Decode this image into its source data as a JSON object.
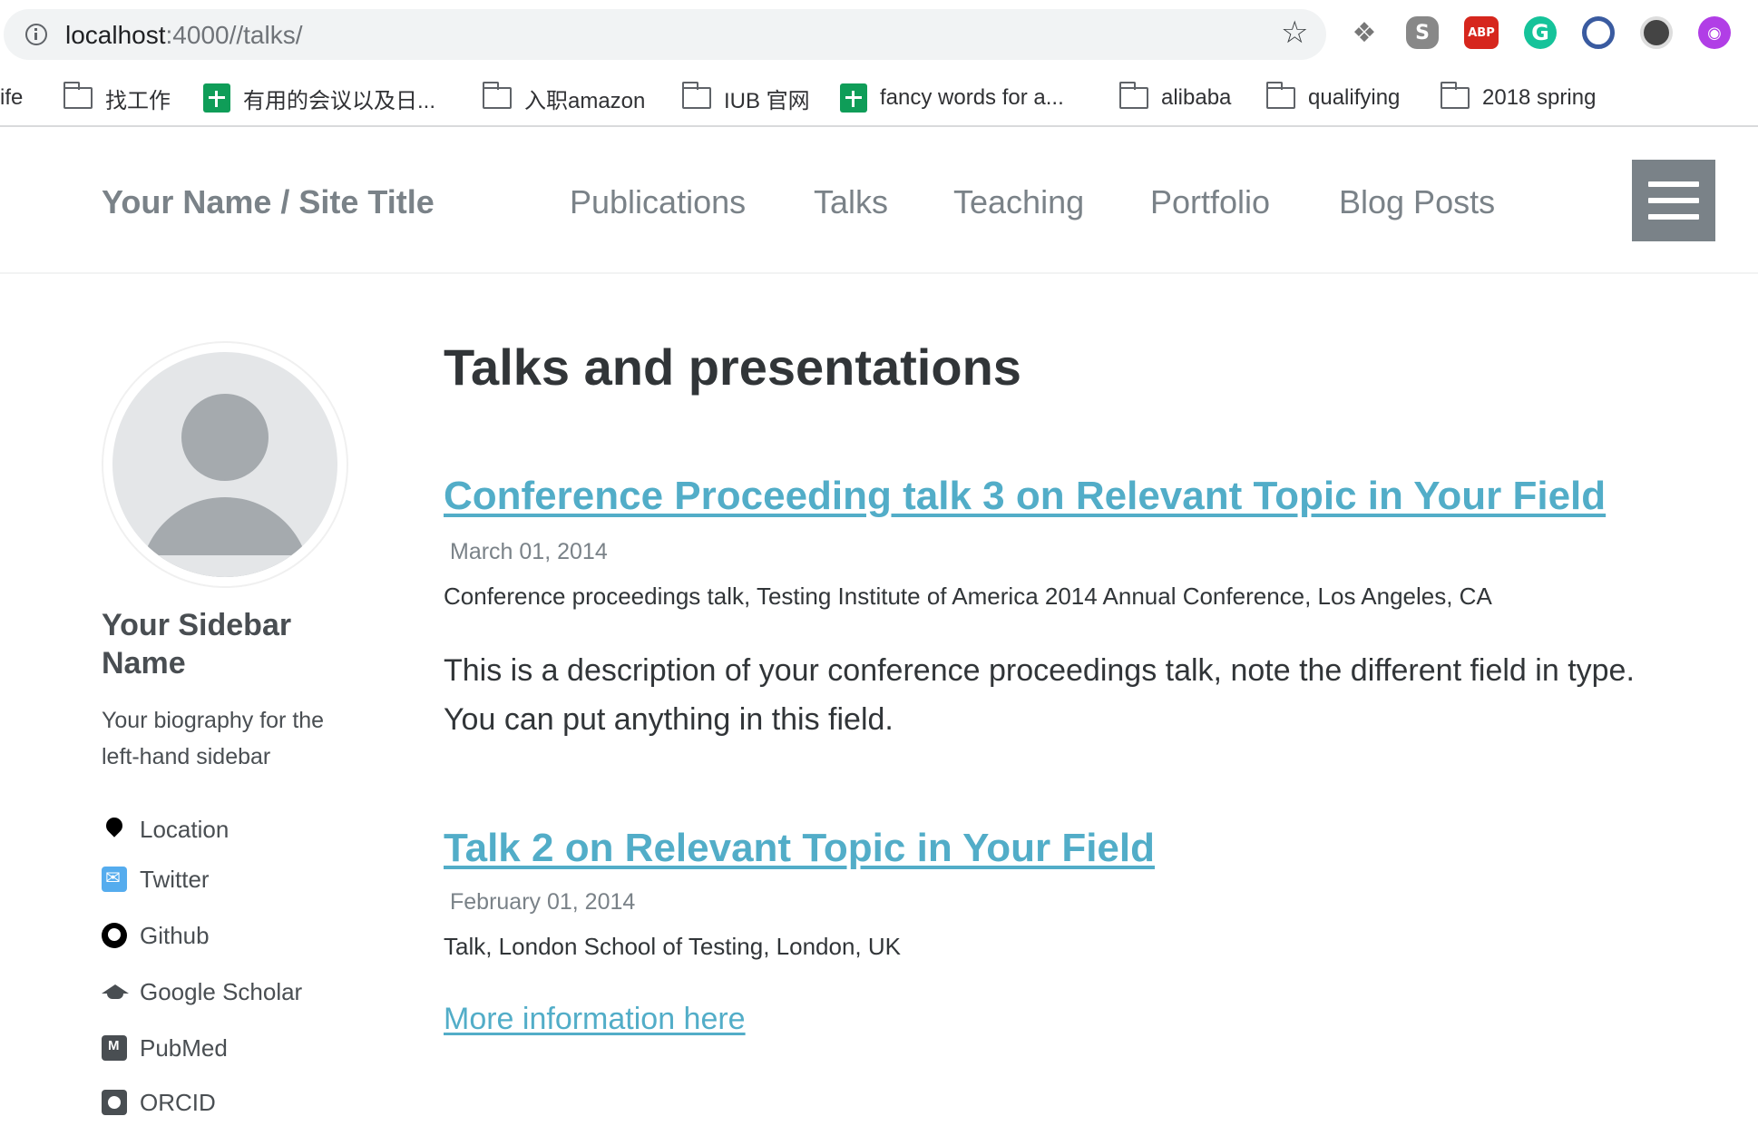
{
  "browser": {
    "url_host": "localhost",
    "url_rest": ":4000//talks/",
    "extensions": [
      "dropbox-icon",
      "skype-icon",
      "adblock-plus-icon",
      "grammarly-icon",
      "q-extension-icon",
      "moon-extension-icon",
      "octo-extension-icon"
    ],
    "abp_label": "ABP",
    "grammarly_label": "G",
    "bookmarks": [
      {
        "label": "ife",
        "icon": "none"
      },
      {
        "label": "找工作",
        "icon": "folder-icon"
      },
      {
        "label": "有用的会议以及日...",
        "icon": "sheets-icon"
      },
      {
        "label": "入职amazon",
        "icon": "folder-icon"
      },
      {
        "label": "IUB 官网",
        "icon": "folder-icon"
      },
      {
        "label": "fancy words for a...",
        "icon": "sheets-icon"
      },
      {
        "label": "alibaba",
        "icon": "folder-icon"
      },
      {
        "label": "qualifying",
        "icon": "folder-icon"
      },
      {
        "label": "2018 spring",
        "icon": "folder-icon"
      }
    ]
  },
  "site": {
    "title": "Your Name / Site Title",
    "nav": [
      "Publications",
      "Talks",
      "Teaching",
      "Portfolio",
      "Blog Posts"
    ]
  },
  "sidebar": {
    "name": "Your Sidebar Name",
    "bio": "Your biography for the left-hand sidebar",
    "links": [
      {
        "label": "Location",
        "icon": "location-pin-icon"
      },
      {
        "label": "Twitter",
        "icon": "twitter-icon"
      },
      {
        "label": "Github",
        "icon": "github-icon"
      },
      {
        "label": "Google Scholar",
        "icon": "graduation-cap-icon"
      },
      {
        "label": "PubMed",
        "icon": "pubmed-icon"
      },
      {
        "label": "ORCID",
        "icon": "orcid-icon"
      }
    ]
  },
  "main": {
    "title": "Talks and presentations",
    "talks": [
      {
        "title": "Conference Proceeding talk 3 on Relevant Topic in Your Field",
        "date": "March 01, 2014",
        "type_venue": "Conference proceedings talk, Testing Institute of America 2014 Annual Conference, Los Angeles, CA",
        "description": "This is a description of your conference proceedings talk, note the different field in type. You can put anything in this field."
      },
      {
        "title": "Talk 2 on Relevant Topic in Your Field",
        "date": "February 01, 2014",
        "type_venue": "Talk, London School of Testing, London, UK",
        "link_text": "More information here"
      }
    ]
  },
  "colors": {
    "link": "#52adc8",
    "nav_text": "#7a8288",
    "body_text": "#494e52",
    "heading": "#313538"
  }
}
